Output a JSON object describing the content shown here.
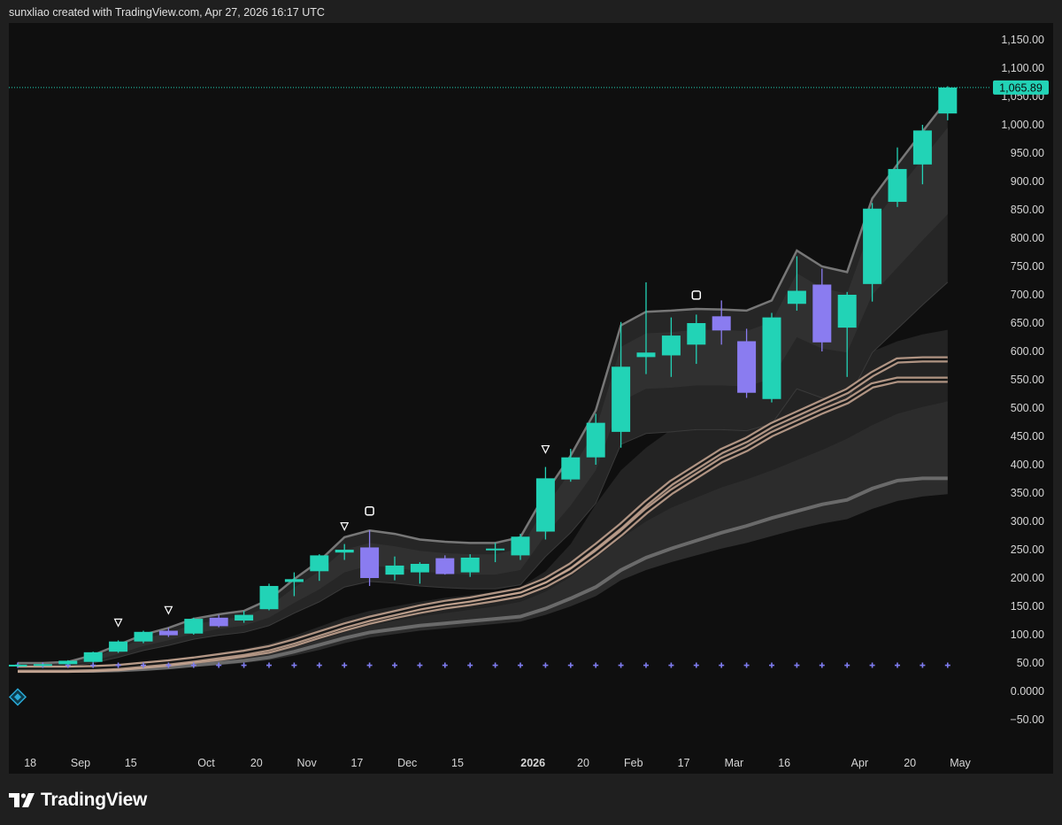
{
  "header": {
    "attribution": "sunxliao created with TradingView.com, Apr 27, 2026 16:17 UTC"
  },
  "footer": {
    "brand": "TradingView",
    "logo_icon": "tradingview-logo-icon"
  },
  "colors": {
    "up": "#22d3b6",
    "down": "#8a7cf0",
    "band_fill": "#3a3a3a",
    "ma_outer": "#c9a894",
    "ma_inner": "#1a1a1a",
    "lower_line": "#6a6a6a",
    "marker_blue": "#7f7cf0",
    "last_price_bg": "#22d3b6"
  },
  "chart_data": {
    "type": "candlestick",
    "ylim": [
      -60,
      1170
    ],
    "y_ticks": [
      1150,
      1100,
      1050,
      1000,
      950,
      900,
      850,
      800,
      750,
      700,
      650,
      600,
      550,
      500,
      450,
      400,
      350,
      300,
      250,
      200,
      150,
      100,
      50,
      0,
      -50
    ],
    "y_tick_labels": [
      "1,150.00",
      "1,100.00",
      "1,050.00",
      "1,000.00",
      "950.00",
      "900.00",
      "850.00",
      "800.00",
      "750.00",
      "700.00",
      "650.00",
      "600.00",
      "550.00",
      "500.00",
      "450.00",
      "400.00",
      "350.00",
      "300.00",
      "250.00",
      "200.00",
      "150.00",
      "100.00",
      "50.00",
      "0.0000",
      "−50.00"
    ],
    "x_ticks": [
      {
        "i": 0.5,
        "label": "18",
        "bold": false
      },
      {
        "i": 2.5,
        "label": "Sep",
        "bold": false
      },
      {
        "i": 4.5,
        "label": "15",
        "bold": false
      },
      {
        "i": 7.5,
        "label": "Oct",
        "bold": false
      },
      {
        "i": 9.5,
        "label": "20",
        "bold": false
      },
      {
        "i": 11.5,
        "label": "Nov",
        "bold": false
      },
      {
        "i": 13.5,
        "label": "17",
        "bold": false
      },
      {
        "i": 15.5,
        "label": "Dec",
        "bold": false
      },
      {
        "i": 17.5,
        "label": "15",
        "bold": false
      },
      {
        "i": 20.5,
        "label": "2026",
        "bold": true
      },
      {
        "i": 22.5,
        "label": "20",
        "bold": false
      },
      {
        "i": 24.5,
        "label": "Feb",
        "bold": false
      },
      {
        "i": 26.5,
        "label": "17",
        "bold": false
      },
      {
        "i": 28.5,
        "label": "Mar",
        "bold": false
      },
      {
        "i": 30.5,
        "label": "16",
        "bold": false
      },
      {
        "i": 33.5,
        "label": "Apr",
        "bold": false
      },
      {
        "i": 35.5,
        "label": "20",
        "bold": false
      },
      {
        "i": 37.5,
        "label": "May",
        "bold": false
      }
    ],
    "last_price": 1065.89,
    "last_price_label": "1,065.89",
    "candles": [
      {
        "o": 46,
        "h": 48,
        "l": 44,
        "c": 47
      },
      {
        "o": 46,
        "h": 48,
        "l": 44,
        "c": 48
      },
      {
        "o": 48,
        "h": 55,
        "l": 47,
        "c": 54
      },
      {
        "o": 52,
        "h": 70,
        "l": 51,
        "c": 69
      },
      {
        "o": 70,
        "h": 90,
        "l": 68,
        "c": 88
      },
      {
        "o": 88,
        "h": 107,
        "l": 85,
        "c": 105
      },
      {
        "o": 107,
        "h": 112,
        "l": 96,
        "c": 99
      },
      {
        "o": 102,
        "h": 130,
        "l": 100,
        "c": 128
      },
      {
        "o": 130,
        "h": 135,
        "l": 113,
        "c": 115
      },
      {
        "o": 125,
        "h": 142,
        "l": 121,
        "c": 135
      },
      {
        "o": 145,
        "h": 190,
        "l": 143,
        "c": 186
      },
      {
        "o": 193,
        "h": 210,
        "l": 168,
        "c": 198
      },
      {
        "o": 212,
        "h": 242,
        "l": 195,
        "c": 240
      },
      {
        "o": 245,
        "h": 260,
        "l": 232,
        "c": 250
      },
      {
        "o": 254,
        "h": 284,
        "l": 186,
        "c": 200
      },
      {
        "o": 206,
        "h": 238,
        "l": 196,
        "c": 222
      },
      {
        "o": 210,
        "h": 228,
        "l": 190,
        "c": 225
      },
      {
        "o": 235,
        "h": 240,
        "l": 206,
        "c": 207
      },
      {
        "o": 210,
        "h": 242,
        "l": 202,
        "c": 236
      },
      {
        "o": 250,
        "h": 262,
        "l": 228,
        "c": 252
      },
      {
        "o": 240,
        "h": 278,
        "l": 232,
        "c": 273
      },
      {
        "o": 282,
        "h": 396,
        "l": 268,
        "c": 376
      },
      {
        "o": 374,
        "h": 428,
        "l": 370,
        "c": 413
      },
      {
        "o": 413,
        "h": 490,
        "l": 400,
        "c": 474
      },
      {
        "o": 458,
        "h": 652,
        "l": 430,
        "c": 573
      },
      {
        "o": 590,
        "h": 722,
        "l": 560,
        "c": 598
      },
      {
        "o": 593,
        "h": 660,
        "l": 555,
        "c": 628
      },
      {
        "o": 612,
        "h": 665,
        "l": 578,
        "c": 650
      },
      {
        "o": 662,
        "h": 690,
        "l": 612,
        "c": 637
      },
      {
        "o": 618,
        "h": 640,
        "l": 518,
        "c": 527
      },
      {
        "o": 516,
        "h": 668,
        "l": 510,
        "c": 660
      },
      {
        "o": 684,
        "h": 768,
        "l": 672,
        "c": 707
      },
      {
        "o": 718,
        "h": 746,
        "l": 600,
        "c": 616
      },
      {
        "o": 642,
        "h": 705,
        "l": 555,
        "c": 700
      },
      {
        "o": 719,
        "h": 862,
        "l": 688,
        "c": 852
      },
      {
        "o": 864,
        "h": 960,
        "l": 855,
        "c": 922
      },
      {
        "o": 930,
        "h": 1000,
        "l": 895,
        "c": 990
      },
      {
        "o": 1020,
        "h": 1068,
        "l": 1008,
        "c": 1065.89
      }
    ],
    "band_upper": [
      50,
      50,
      52,
      64,
      82,
      100,
      112,
      128,
      136,
      142,
      162,
      198,
      230,
      272,
      284,
      278,
      268,
      264,
      262,
      262,
      272,
      350,
      416,
      496,
      646,
      670,
      672,
      675,
      674,
      672,
      690,
      778,
      750,
      740,
      870,
      930,
      988,
      1045
    ],
    "band_upper2": [
      48,
      48,
      50,
      60,
      76,
      93,
      104,
      118,
      126,
      132,
      150,
      183,
      212,
      250,
      262,
      256,
      248,
      244,
      242,
      242,
      252,
      326,
      388,
      462,
      608,
      632,
      634,
      638,
      638,
      636,
      652,
      738,
      712,
      702,
      826,
      884,
      940,
      995
    ],
    "band_lower2": [
      44,
      44,
      46,
      54,
      66,
      80,
      90,
      102,
      110,
      116,
      130,
      156,
      180,
      210,
      222,
      218,
      212,
      208,
      206,
      206,
      214,
      276,
      328,
      390,
      512,
      534,
      536,
      540,
      540,
      538,
      552,
      625,
      605,
      598,
      700,
      748,
      796,
      842
    ],
    "band_lower": [
      42,
      42,
      44,
      50,
      60,
      72,
      81,
      92,
      99,
      104,
      116,
      138,
      158,
      184,
      194,
      191,
      186,
      183,
      181,
      181,
      188,
      238,
      280,
      332,
      436,
      455,
      458,
      462,
      462,
      460,
      472,
      534,
      518,
      512,
      598,
      640,
      682,
      722
    ],
    "ma_a": [
      40,
      40,
      40,
      41,
      43,
      47,
      51,
      56,
      62,
      68,
      76,
      88,
      102,
      116,
      128,
      138,
      148,
      156,
      162,
      170,
      178,
      196,
      222,
      256,
      292,
      332,
      368,
      396,
      424,
      444,
      470,
      490,
      510,
      530,
      560,
      584,
      586,
      586
    ],
    "ma_b": [
      38,
      38,
      38,
      39,
      41,
      45,
      49,
      54,
      59,
      65,
      72,
      84,
      98,
      111,
      123,
      133,
      142,
      150,
      156,
      163,
      171,
      188,
      212,
      244,
      279,
      318,
      352,
      380,
      408,
      428,
      454,
      474,
      494,
      512,
      540,
      550,
      550,
      550
    ],
    "lower_line": [
      36,
      36,
      36,
      36,
      37,
      39,
      42,
      46,
      50,
      54,
      60,
      70,
      82,
      94,
      104,
      110,
      116,
      120,
      124,
      128,
      132,
      146,
      164,
      184,
      214,
      236,
      252,
      266,
      280,
      292,
      306,
      318,
      330,
      338,
      358,
      372,
      376,
      376
    ],
    "fan1_upper": [
      44,
      44,
      44,
      46,
      48,
      52,
      57,
      62,
      68,
      75,
      84,
      98,
      114,
      130,
      142,
      150,
      158,
      165,
      170,
      176,
      184,
      212,
      260,
      330,
      390,
      430,
      462,
      480,
      500,
      510,
      520,
      535,
      550,
      570,
      600,
      618,
      630,
      638
    ],
    "fan1_lower": [
      36,
      36,
      36,
      37,
      38,
      40,
      43,
      47,
      51,
      56,
      63,
      73,
      85,
      98,
      110,
      118,
      126,
      132,
      138,
      144,
      152,
      170,
      196,
      228,
      262,
      290,
      310,
      328,
      345,
      360,
      378,
      398,
      416,
      436,
      462,
      482,
      496,
      508
    ],
    "fan2_upper": [
      40,
      40,
      40,
      41,
      42,
      45,
      48,
      52,
      56,
      61,
      68,
      78,
      90,
      104,
      116,
      124,
      132,
      138,
      144,
      150,
      158,
      176,
      202,
      236,
      270,
      300,
      324,
      342,
      360,
      374,
      390,
      408,
      426,
      446,
      470,
      490,
      502,
      512
    ],
    "fan2_lower": [
      36,
      36,
      36,
      36,
      37,
      38,
      40,
      43,
      46,
      50,
      55,
      63,
      73,
      85,
      95,
      101,
      107,
      111,
      115,
      119,
      123,
      135,
      150,
      168,
      196,
      214,
      228,
      240,
      252,
      262,
      274,
      286,
      296,
      304,
      322,
      336,
      344,
      348
    ],
    "cross_markers_y": 46,
    "triangle_markers": [
      4,
      6,
      13,
      21
    ],
    "square_markers": [
      14,
      27
    ],
    "diamond_marker_y": -10
  }
}
